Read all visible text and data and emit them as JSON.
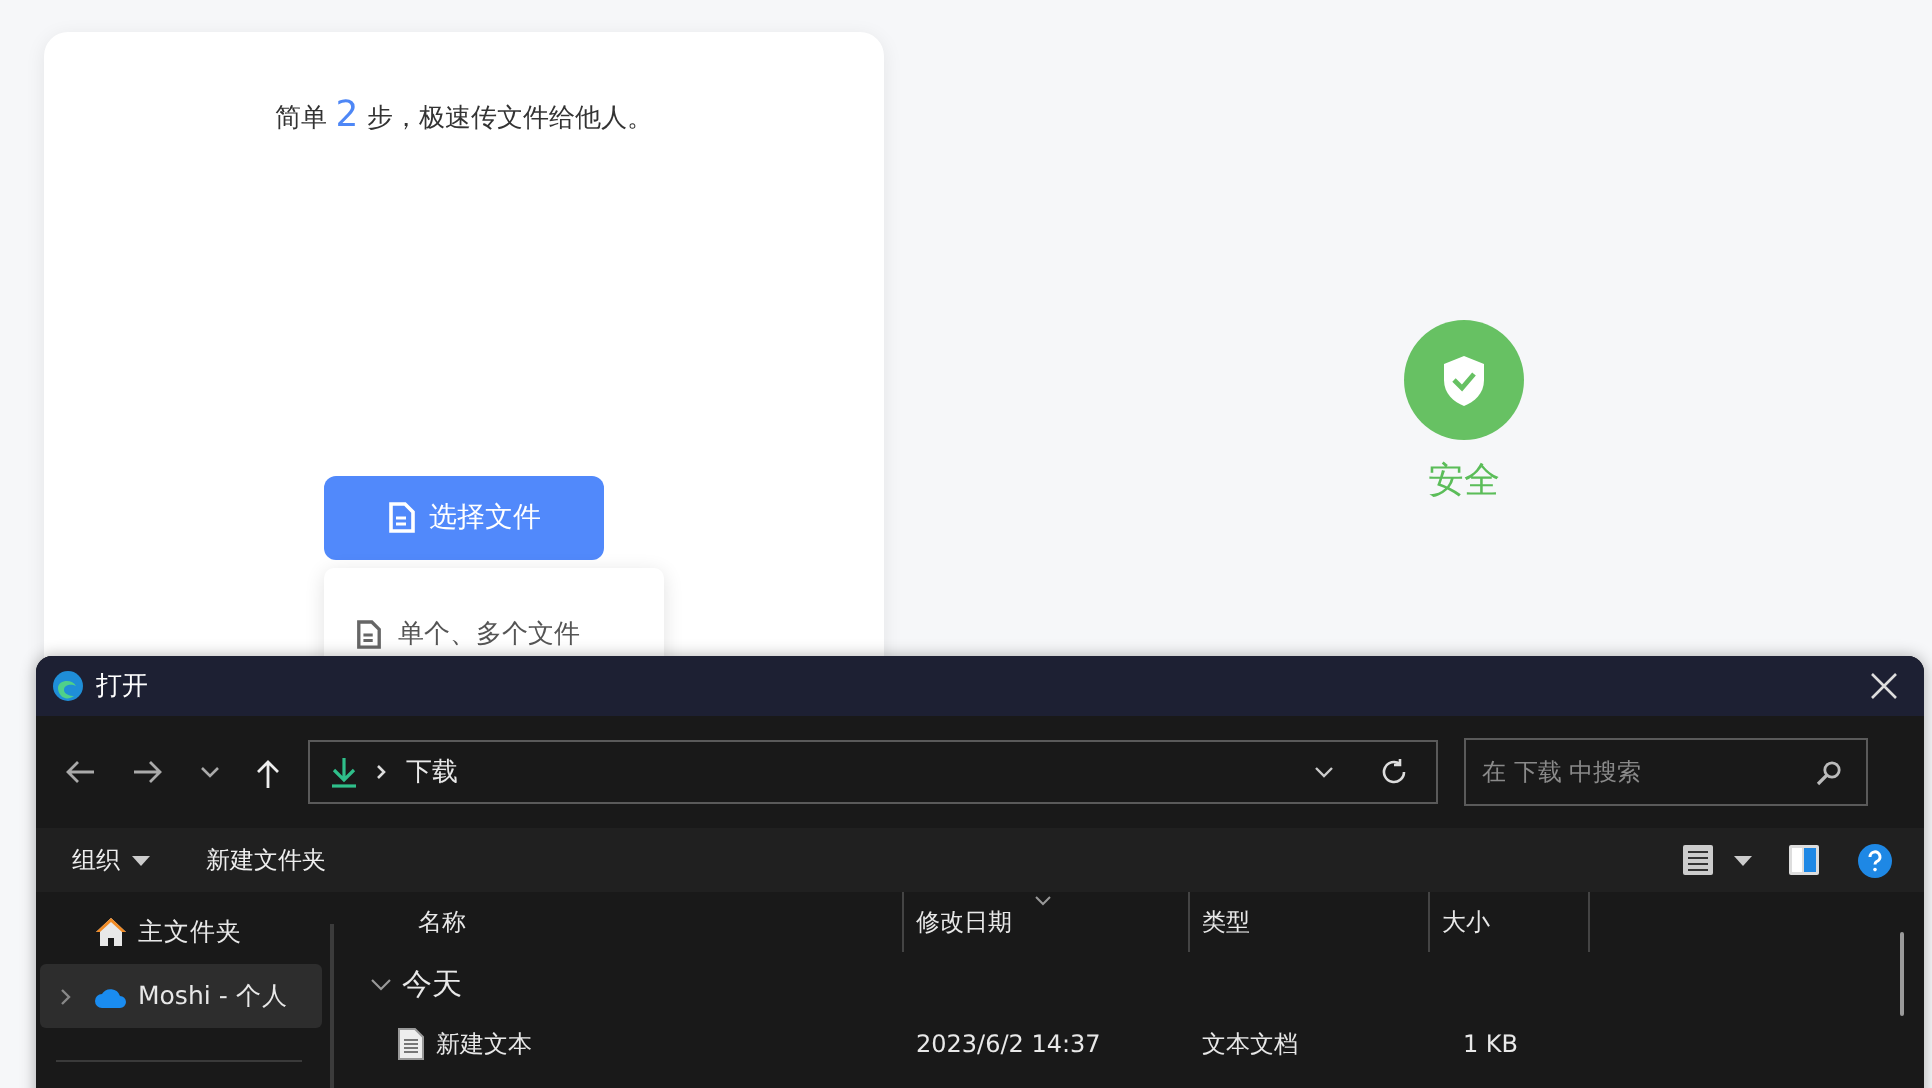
{
  "card": {
    "headline": "简单 **2** 步，极速传文件给他人。",
    "choose_button": "选择文件",
    "menu_items": [
      "单个、多个文件"
    ]
  },
  "security": {
    "label": "安全"
  },
  "dialog": {
    "title": "打开",
    "path": [
      "下载"
    ],
    "search": {
      "placeholder": "在 下载 中搜索"
    },
    "commands": [
      {
        "label": "组织",
        "dropdown": true
      },
      {
        "label": "新建文件夹",
        "dropdown": false
      }
    ],
    "sidebar": [
      {
        "label": "主文件夹",
        "kind": "home",
        "selected": false
      },
      {
        "label": "Moshi - 个人",
        "kind": "cloud",
        "selected": true
      }
    ],
    "columns": [
      "名称",
      "修改日期",
      "类型",
      "大小"
    ],
    "groups": [
      {
        "label": "今天",
        "expanded": true,
        "files": [
          {
            "name": "新建文本",
            "modified": "2023/6/2 14:37",
            "type": "文本文档",
            "size": "1 KB"
          }
        ]
      }
    ]
  }
}
